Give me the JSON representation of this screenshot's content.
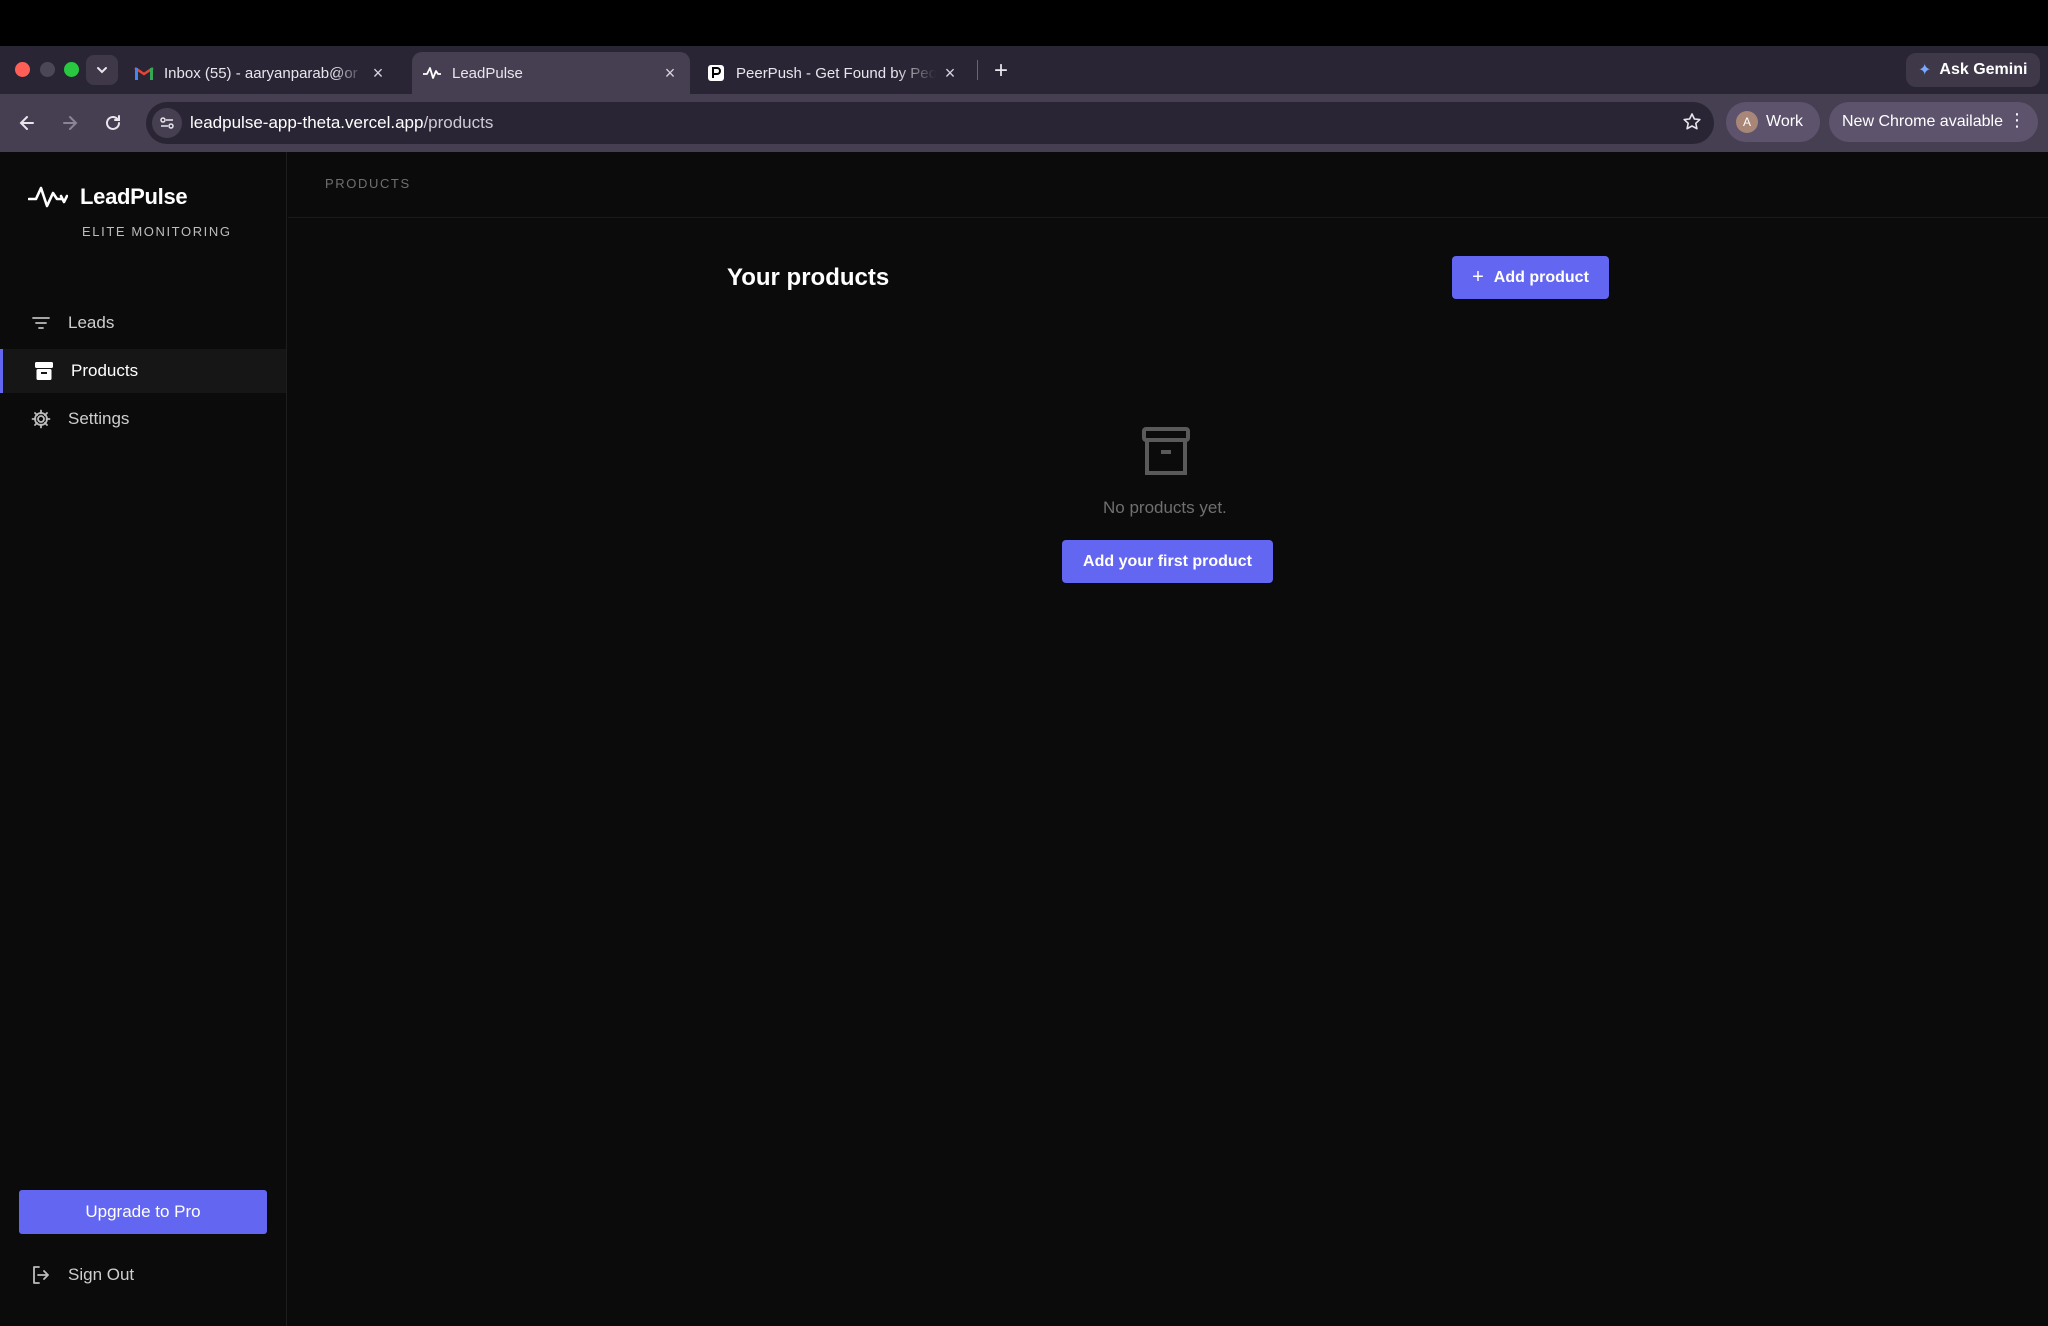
{
  "browser": {
    "tabs": [
      {
        "title": "Inbox (55) - aaryanparab@or",
        "favicon": "gmail-icon"
      },
      {
        "title": "LeadPulse",
        "favicon": "pulse-icon",
        "active": true
      },
      {
        "title": "PeerPush - Get Found by Peo",
        "favicon": "peerpush-icon"
      }
    ],
    "gemini_label": "Ask Gemini",
    "url_host": "leadpulse-app-theta.vercel.app",
    "url_path": "/products",
    "profile_initial": "A",
    "profile_label": "Work",
    "update_label": "New Chrome available"
  },
  "sidebar": {
    "brand": "LeadPulse",
    "tagline": "ELITE MONITORING",
    "items": [
      {
        "label": "Leads",
        "icon": "filter-lines-icon"
      },
      {
        "label": "Products",
        "icon": "archive-box-icon",
        "active": true
      },
      {
        "label": "Settings",
        "icon": "gear-icon"
      }
    ],
    "upgrade_label": "Upgrade to Pro",
    "signout_label": "Sign Out"
  },
  "main": {
    "breadcrumb": "PRODUCTS",
    "title": "Your products",
    "add_button": "Add product",
    "empty_text": "No products yet.",
    "first_button": "Add your first product"
  },
  "colors": {
    "accent": "#6366f1",
    "background": "#0b0b0b",
    "tab_bar": "#2a2534",
    "toolbar": "#463f52"
  }
}
